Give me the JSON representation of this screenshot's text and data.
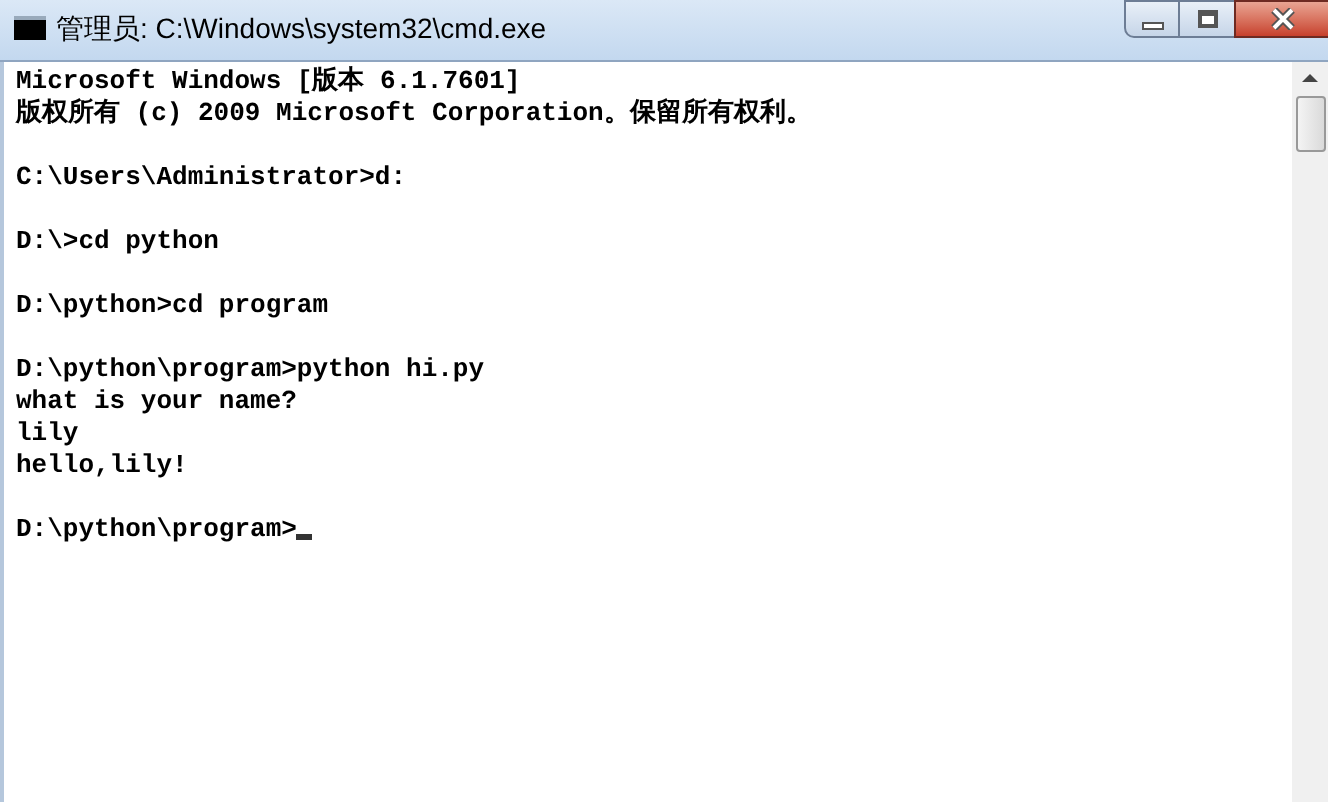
{
  "window": {
    "title": "管理员: C:\\Windows\\system32\\cmd.exe"
  },
  "console": {
    "blocks": [
      [
        "Microsoft Windows [版本 6.1.7601]",
        "版权所有 (c) 2009 Microsoft Corporation。保留所有权利。"
      ],
      [
        "C:\\Users\\Administrator>d:"
      ],
      [
        "D:\\>cd python"
      ],
      [
        "D:\\python>cd program"
      ],
      [
        "D:\\python\\program>python hi.py",
        "what is your name?",
        "lily",
        "hello,lily!"
      ],
      [
        "D:\\python\\program>"
      ]
    ],
    "cursor": true
  }
}
